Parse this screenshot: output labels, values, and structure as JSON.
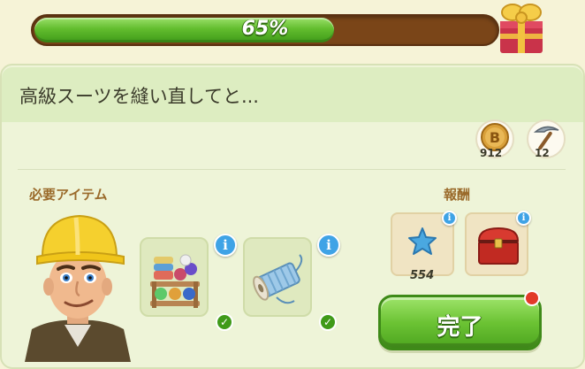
{
  "progress": {
    "value_percent": 65,
    "label": "65%"
  },
  "task": {
    "title": "高級スーツを縫い直してと..."
  },
  "resources": [
    {
      "icon": "bitcoin-coin-icon",
      "count": "912"
    },
    {
      "icon": "pickaxe-icon",
      "count": "12"
    }
  ],
  "sections": {
    "required_items": "必要アイテム",
    "rewards": "報酬"
  },
  "required_items": [
    {
      "icon": "fabric-rolls-shelf-icon",
      "info": "i",
      "fulfilled": true
    },
    {
      "icon": "thread-spool-icon",
      "info": "i",
      "fulfilled": true
    }
  ],
  "rewards": [
    {
      "icon": "blue-star-icon",
      "info": "i",
      "count": "554"
    },
    {
      "icon": "red-chest-icon",
      "info": "i"
    }
  ],
  "complete_button": {
    "label": "完了"
  },
  "colors": {
    "accent_green": "#62bd2e",
    "track_brown": "#7a4518",
    "info_blue": "#3fa3e6",
    "notify_red": "#e23a2a"
  }
}
